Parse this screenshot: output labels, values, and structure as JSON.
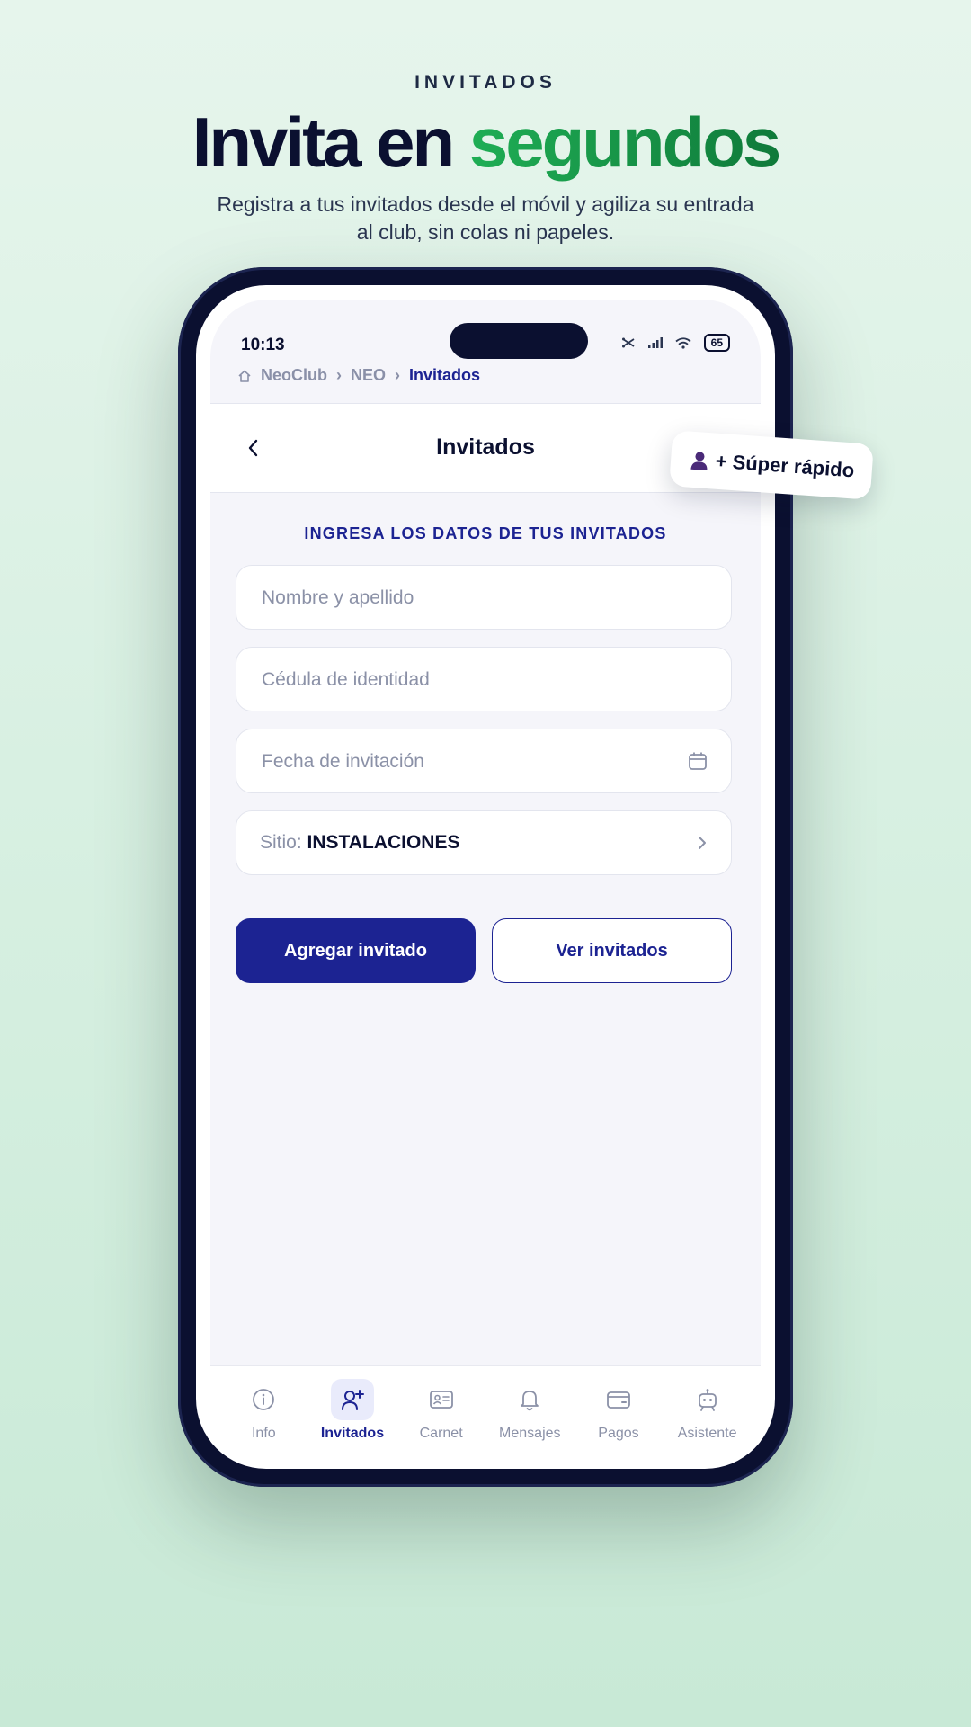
{
  "header": {
    "eyebrow": "INVITADOS",
    "headline_part1": "Invita en ",
    "headline_accent": "segundos",
    "subtitle": "Registra a tus invitados desde el móvil y agiliza su entrada al club, sin colas ni papeles."
  },
  "sticker": {
    "label": "+ Súper rápido",
    "icon": "person-icon"
  },
  "status_bar": {
    "time": "10:13",
    "battery": "65"
  },
  "breadcrumb": {
    "home": "NeoClub",
    "middle": "NEO",
    "current": "Invitados"
  },
  "topbar": {
    "title": "Invitados"
  },
  "form": {
    "section_title": "INGRESA LOS DATOS DE TUS INVITADOS",
    "name_placeholder": "Nombre y apellido",
    "id_placeholder": "Cédula de identidad",
    "date_placeholder": "Fecha de invitación",
    "site_label": "Sitio:",
    "site_value": "INSTALACIONES"
  },
  "buttons": {
    "add": "Agregar invitado",
    "view": "Ver invitados"
  },
  "tabs": [
    {
      "label": "Info",
      "icon": "info-icon",
      "active": false
    },
    {
      "label": "Invitados",
      "icon": "add-user-icon",
      "active": true
    },
    {
      "label": "Carnet",
      "icon": "id-card-icon",
      "active": false
    },
    {
      "label": "Mensajes",
      "icon": "bell-icon",
      "active": false
    },
    {
      "label": "Pagos",
      "icon": "wallet-icon",
      "active": false
    },
    {
      "label": "Asistente",
      "icon": "bot-icon",
      "active": false
    }
  ],
  "colors": {
    "primary": "#1c2392",
    "accent": "#16a34a",
    "dark": "#0b1030",
    "background": "#d8f0e2"
  }
}
